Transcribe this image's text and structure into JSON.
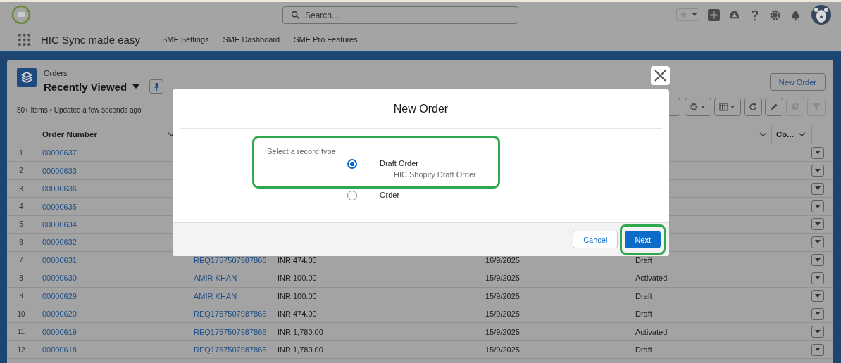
{
  "header": {
    "search": {
      "placeholder": "Search..."
    }
  },
  "app": {
    "name": "HIC Sync made easy",
    "tabs": [
      {
        "label": "SME Settings"
      },
      {
        "label": "SME Dashboard"
      },
      {
        "label": "SME Pro Features"
      }
    ]
  },
  "list_view": {
    "object": "Orders",
    "view": "Recently Viewed",
    "status": "50+ items • Updated a few seconds ago",
    "new_button": "New Order",
    "toolbar": [
      {
        "kind": "settings",
        "disabled": false
      },
      {
        "kind": "table",
        "disabled": false
      },
      {
        "kind": "refresh",
        "disabled": false
      },
      {
        "kind": "edit",
        "disabled": false
      },
      {
        "kind": "chart",
        "disabled": true
      },
      {
        "kind": "filter",
        "disabled": true
      }
    ],
    "headers": {
      "order_number": "Order Number",
      "column_7": "Co..."
    },
    "rows": [
      {
        "number": "1",
        "order": "00000637"
      },
      {
        "number": "2",
        "order": "00000633"
      },
      {
        "number": "3",
        "order": "00000636"
      },
      {
        "number": "4",
        "order": "00000635"
      },
      {
        "number": "5",
        "order": "00000634"
      },
      {
        "number": "6",
        "order": "00000632"
      },
      {
        "number": "7",
        "order": "00000631",
        "customer": "REQ1757507987866",
        "amount": "INR 474.00",
        "date": "16/9/2025",
        "status": "Draft"
      },
      {
        "number": "8",
        "order": "00000630",
        "customer": "AMIR KHAN",
        "amount": "INR 100.00",
        "date": "15/9/2025",
        "status": "Activated"
      },
      {
        "number": "9",
        "order": "00000629",
        "customer": "AMIR KHAN",
        "amount": "INR 100.00",
        "date": "15/9/2025",
        "status": "Draft"
      },
      {
        "number": "10",
        "order": "00000620",
        "customer": "REQ1757507987866",
        "amount": "INR 474.00",
        "date": "15/9/2025",
        "status": "Draft"
      },
      {
        "number": "11",
        "order": "00000619",
        "customer": "REQ1757507987866",
        "amount": "INR 1,780.00",
        "date": "15/9/2025",
        "status": "Activated"
      },
      {
        "number": "12",
        "order": "00000618",
        "customer": "REQ1757507987866",
        "amount": "INR 1,780.00",
        "date": "15/9/2025",
        "status": "Draft"
      }
    ]
  },
  "modal": {
    "title": "New Order",
    "prompt": "Select a record type",
    "highlighted": true,
    "options": [
      {
        "label": "Draft Order",
        "description": "HIC Shopify Draft Order",
        "selected": true
      },
      {
        "label": "Order",
        "selected": false
      }
    ],
    "buttons": [
      {
        "label": "Cancel",
        "kind": "neutral",
        "highlighted": false
      },
      {
        "label": "Next",
        "kind": "brand",
        "highlighted": true
      }
    ]
  }
}
